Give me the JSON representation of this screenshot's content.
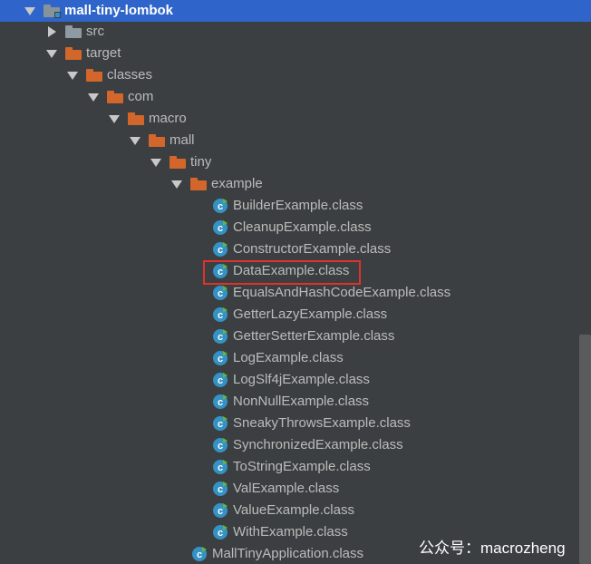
{
  "project": {
    "root_label": "mall-tiny-lombok",
    "src_label": "src",
    "target_label": "target",
    "classes_label": "classes",
    "com_label": "com",
    "macro_label": "macro",
    "mall_label": "mall",
    "tiny_label": "tiny",
    "example_label": "example",
    "app_class_label": "MallTinyApplication.class"
  },
  "example_files": [
    "BuilderExample.class",
    "CleanupExample.class",
    "ConstructorExample.class",
    "DataExample.class",
    "EqualsAndHashCodeExample.class",
    "GetterLazyExample.class",
    "GetterSetterExample.class",
    "LogExample.class",
    "LogSlf4jExample.class",
    "NonNullExample.class",
    "SneakyThrowsExample.class",
    "SynchronizedExample.class",
    "ToStringExample.class",
    "ValExample.class",
    "ValueExample.class",
    "WithExample.class"
  ],
  "highlighted_file": "DataExample.class",
  "watermark": "公众号：macrozheng",
  "colors": {
    "background": "#3c3f41",
    "selection": "#2f65ca",
    "folder_orange": "#d3662b",
    "class_icon": "#3592c4",
    "run_badge": "#62b543",
    "highlight_border": "#e0312c"
  }
}
